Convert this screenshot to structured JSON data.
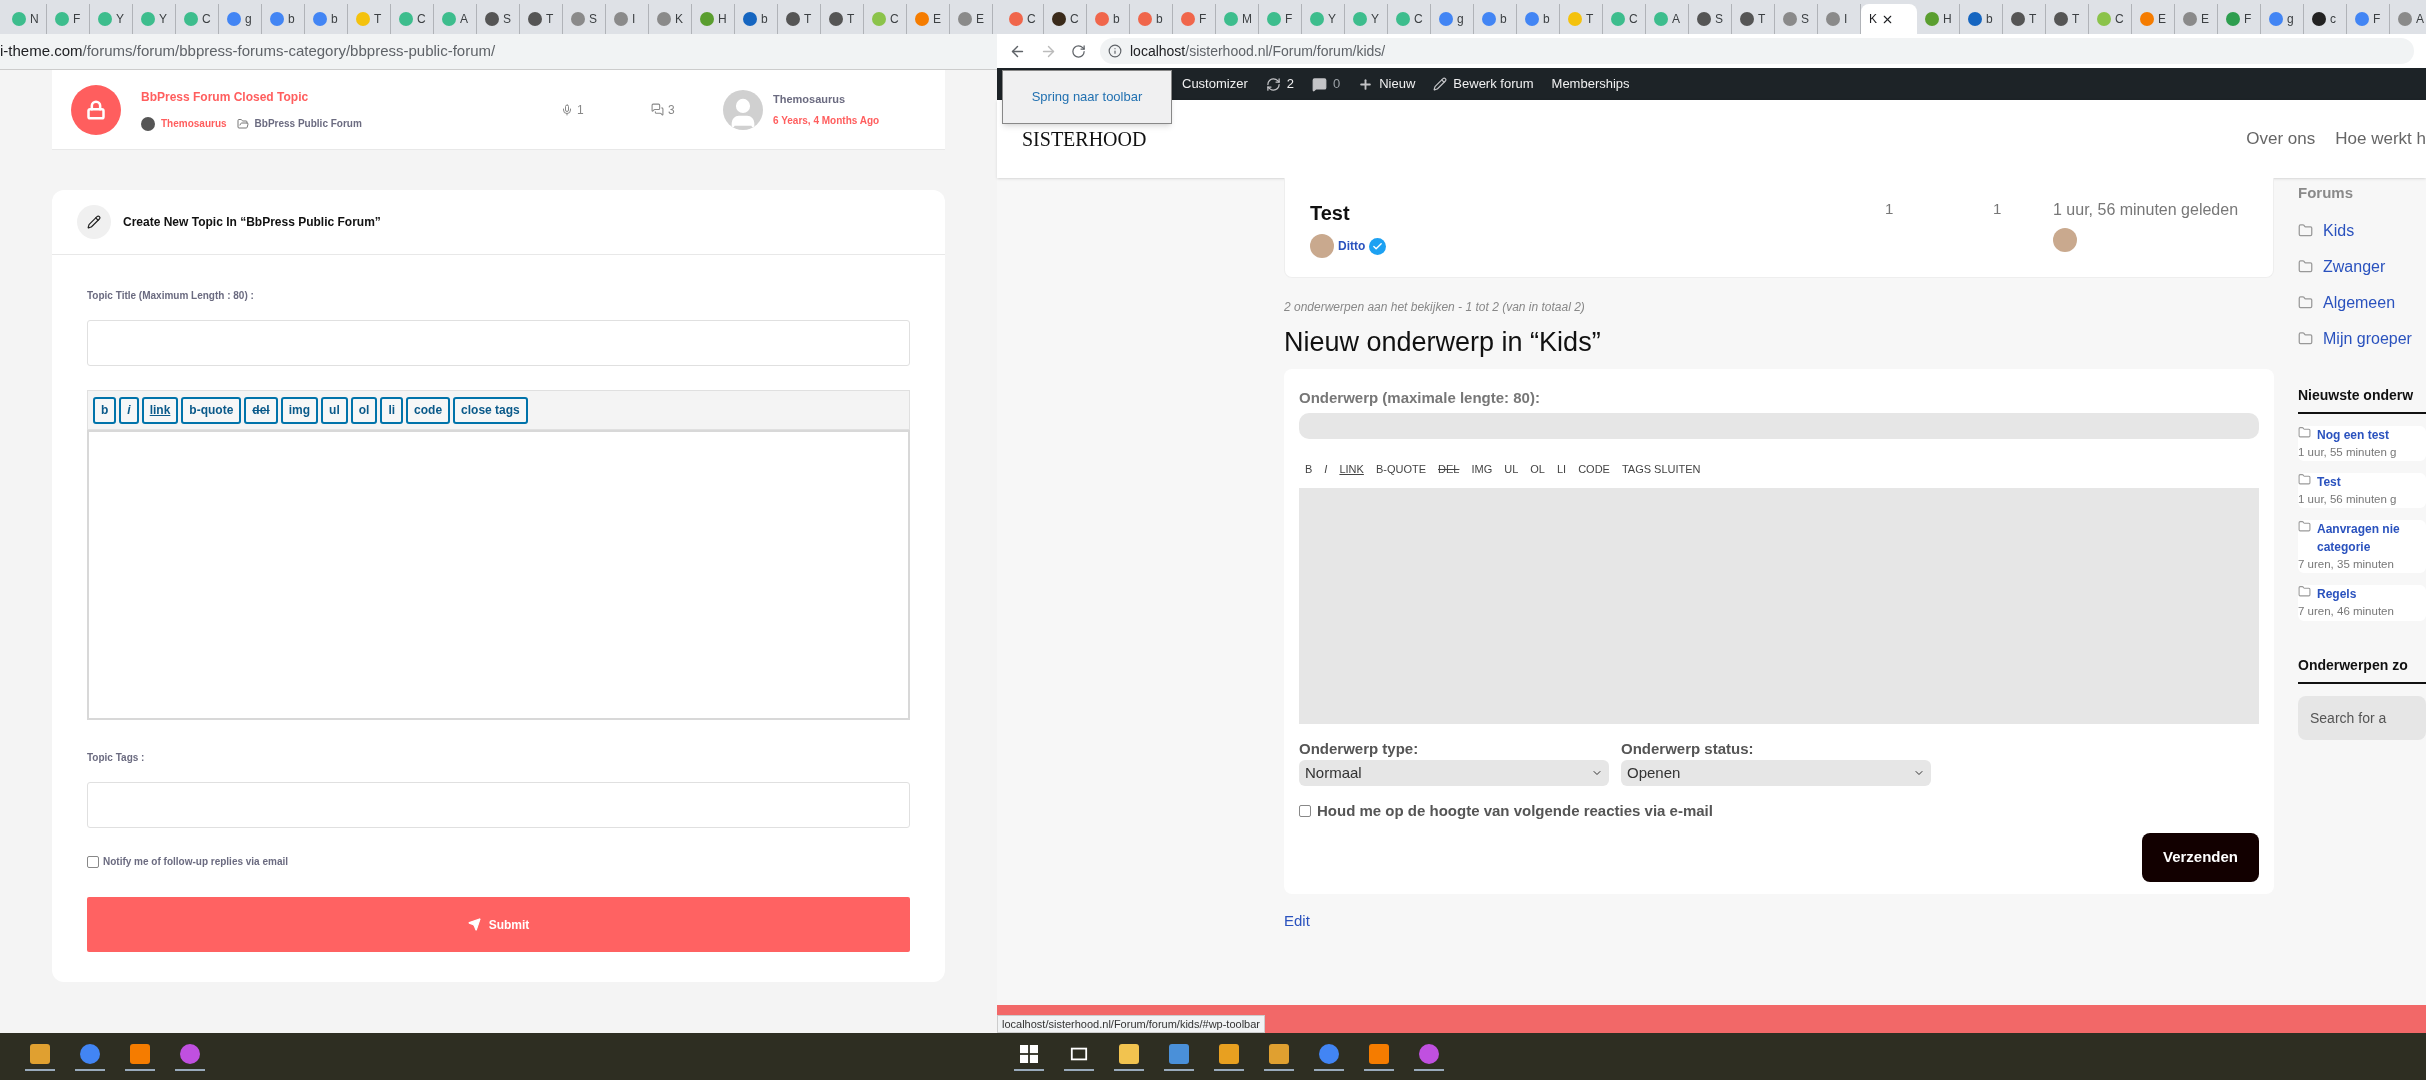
{
  "left_window": {
    "tabs": [
      {
        "title": "N",
        "color": "#3dbd8d",
        "selected": false
      },
      {
        "title": "F",
        "color": "#3dbd8d",
        "selected": false
      },
      {
        "title": "Y",
        "color": "#3dbd8d",
        "selected": false
      },
      {
        "title": "Y",
        "color": "#3dbd8d",
        "selected": false
      },
      {
        "title": "C",
        "color": "#3dbd8d",
        "selected": false
      },
      {
        "title": "g",
        "color": "#4285f4",
        "selected": false
      },
      {
        "title": "b",
        "color": "#4285f4",
        "selected": false
      },
      {
        "title": "b",
        "color": "#4285f4",
        "selected": false
      },
      {
        "title": "T",
        "color": "#f4c20d",
        "selected": false
      },
      {
        "title": "C",
        "color": "#3dbd8d",
        "selected": false
      },
      {
        "title": "A",
        "color": "#3dbd8d",
        "selected": false
      },
      {
        "title": "S",
        "color": "#555555",
        "selected": false
      },
      {
        "title": "T",
        "color": "#555555",
        "selected": false
      },
      {
        "title": "S",
        "color": "#8a8a8a",
        "selected": false
      },
      {
        "title": "I",
        "color": "#8a8a8a",
        "selected": false
      },
      {
        "title": "K",
        "color": "#8a8a8a",
        "selected": false
      },
      {
        "title": "H",
        "color": "#5a9e2f",
        "selected": false
      },
      {
        "title": "b",
        "color": "#1565c0",
        "selected": false
      },
      {
        "title": "T",
        "color": "#555555",
        "selected": false
      },
      {
        "title": "T",
        "color": "#555555",
        "selected": false
      },
      {
        "title": "C",
        "color": "#8bc34a",
        "selected": false
      },
      {
        "title": "E",
        "color": "#f57c00",
        "selected": false
      },
      {
        "title": "E",
        "color": "#8a8a8a",
        "selected": false
      }
    ],
    "address": {
      "domain": "i-theme.com",
      "path": "/forums/forum/bbpress-forums-category/bbpress-public-forum/"
    },
    "topic": {
      "title": "BbPress Forum Closed Topic",
      "author": "Themosaurus",
      "forum": "BbPress Public Forum",
      "voices": "1",
      "replies": "3",
      "last_author": "Themosaurus",
      "freshness": "6 Years, 4 Months Ago"
    },
    "form": {
      "heading": "Create New Topic In “BbPress Public Forum”",
      "title_label": "Topic Title (Maximum Length : 80) :",
      "toolbar": [
        {
          "label": "b",
          "kind": "bold"
        },
        {
          "label": "i",
          "kind": "italic"
        },
        {
          "label": "link",
          "kind": "link"
        },
        {
          "label": "b-quote",
          "kind": "plain"
        },
        {
          "label": "del",
          "kind": "strike"
        },
        {
          "label": "img",
          "kind": "plain"
        },
        {
          "label": "ul",
          "kind": "plain"
        },
        {
          "label": "ol",
          "kind": "plain"
        },
        {
          "label": "li",
          "kind": "plain"
        },
        {
          "label": "code",
          "kind": "plain"
        },
        {
          "label": "close tags",
          "kind": "plain"
        }
      ],
      "tags_label": "Topic Tags :",
      "notify": {
        "label": "Notify me of follow-up replies via email",
        "checked": false
      },
      "submit": "Submit"
    }
  },
  "right_window": {
    "tabs": [
      {
        "title": "C",
        "color": "#f0664b",
        "selected": false
      },
      {
        "title": "C",
        "color": "#3a2a1a",
        "selected": false
      },
      {
        "title": "b",
        "color": "#f0664b",
        "selected": false
      },
      {
        "title": "b",
        "color": "#f0664b",
        "selected": false
      },
      {
        "title": "F",
        "color": "#f0664b",
        "selected": false
      },
      {
        "title": "M",
        "color": "#3dbd8d",
        "selected": false
      },
      {
        "title": "F",
        "color": "#3dbd8d",
        "selected": false
      },
      {
        "title": "Y",
        "color": "#3dbd8d",
        "selected": false
      },
      {
        "title": "Y",
        "color": "#3dbd8d",
        "selected": false
      },
      {
        "title": "C",
        "color": "#3dbd8d",
        "selected": false
      },
      {
        "title": "g",
        "color": "#4285f4",
        "selected": false
      },
      {
        "title": "b",
        "color": "#4285f4",
        "selected": false
      },
      {
        "title": "b",
        "color": "#4285f4",
        "selected": false
      },
      {
        "title": "T",
        "color": "#f4c20d",
        "selected": false
      },
      {
        "title": "C",
        "color": "#3dbd8d",
        "selected": false
      },
      {
        "title": "A",
        "color": "#3dbd8d",
        "selected": false
      },
      {
        "title": "S",
        "color": "#555555",
        "selected": false
      },
      {
        "title": "T",
        "color": "#555555",
        "selected": false
      },
      {
        "title": "S",
        "color": "#8a8a8a",
        "selected": false
      },
      {
        "title": "I",
        "color": "#8a8a8a",
        "selected": false
      },
      {
        "title": "K",
        "selected": true
      },
      {
        "title": "H",
        "color": "#5a9e2f",
        "selected": false
      },
      {
        "title": "b",
        "color": "#1565c0",
        "selected": false
      },
      {
        "title": "T",
        "color": "#555555",
        "selected": false
      },
      {
        "title": "T",
        "color": "#555555",
        "selected": false
      },
      {
        "title": "C",
        "color": "#8bc34a",
        "selected": false
      },
      {
        "title": "E",
        "color": "#f57c00",
        "selected": false
      },
      {
        "title": "E",
        "color": "#8a8a8a",
        "selected": false
      },
      {
        "title": "F",
        "color": "#2e9e4f",
        "selected": false
      },
      {
        "title": "g",
        "color": "#4285f4",
        "selected": false
      },
      {
        "title": "c",
        "color": "#222222",
        "selected": false
      },
      {
        "title": "F",
        "color": "#4285f4",
        "selected": false
      },
      {
        "title": "A",
        "color": "#8a8a8a",
        "selected": false
      }
    ],
    "address": {
      "host": "localhost",
      "path": "/sisterhood.nl/Forum/forum/kids/"
    },
    "admin_bar": {
      "skip_link": "Spring naar toolbar",
      "items": [
        {
          "kind": "text",
          "label": "Customizer"
        },
        {
          "kind": "updates",
          "label": "2"
        },
        {
          "kind": "comments",
          "label": "0"
        },
        {
          "kind": "new",
          "label": "Nieuw"
        },
        {
          "kind": "edit",
          "label": "Bewerk forum"
        },
        {
          "kind": "text",
          "label": "Memberships"
        }
      ]
    },
    "site": {
      "logo": "SISTERHOOD",
      "nav": [
        "Over ons",
        "Hoe werkt h"
      ]
    },
    "topic": {
      "title": "Test",
      "author": "Ditto",
      "voices": "1",
      "replies": "1",
      "freshness": "1 uur, 56 minuten geleden"
    },
    "pagination": "2 onderwerpen aan het bekijken - 1 tot 2 (van in totaal 2)",
    "form": {
      "heading": "Nieuw onderwerp in “Kids”",
      "title_label": "Onderwerp (maximale lengte: 80):",
      "toolbar": [
        {
          "label": "B",
          "kind": "plain"
        },
        {
          "label": "I",
          "kind": "italic"
        },
        {
          "label": "LINK",
          "kind": "link"
        },
        {
          "label": "B-QUOTE",
          "kind": "plain"
        },
        {
          "label": "DEL",
          "kind": "strike"
        },
        {
          "label": "IMG",
          "kind": "plain"
        },
        {
          "label": "UL",
          "kind": "plain"
        },
        {
          "label": "OL",
          "kind": "plain"
        },
        {
          "label": "LI",
          "kind": "plain"
        },
        {
          "label": "CODE",
          "kind": "plain"
        },
        {
          "label": "TAGS SLUITEN",
          "kind": "plain"
        }
      ],
      "type": {
        "label": "Onderwerp type:",
        "value": "Normaal"
      },
      "status": {
        "label": "Onderwerp status:",
        "value": "Openen"
      },
      "notify": {
        "label": "Houd me op de hoogte van volgende reacties via e-mail",
        "checked": false
      },
      "submit": "Verzenden"
    },
    "edit_link": "Edit",
    "sidebar": {
      "forums_heading": "Forums",
      "forums": [
        "Kids",
        "Zwanger",
        "Algemeen",
        "Mijn groeper"
      ],
      "latest_heading": "Nieuwste onderw",
      "latest": [
        {
          "title": "Nog een test",
          "time": "1 uur, 55 minuten g"
        },
        {
          "title": "Test",
          "time": "1 uur, 56 minuten g"
        },
        {
          "title": "Aanvragen nie categorie",
          "time": "7 uren, 35 minuten"
        },
        {
          "title": "Regels",
          "time": "7 uren, 46 minuten"
        }
      ],
      "search_heading": "Onderwerpen zo",
      "search_placeholder": "Search for a"
    },
    "status_url": "localhost/sisterhood.nl/Forum/forum/kids/#wp-toolbar"
  }
}
